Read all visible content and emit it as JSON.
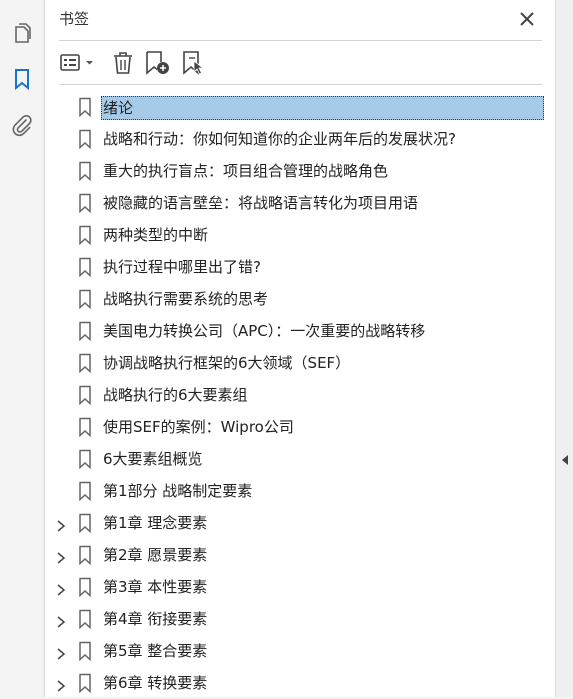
{
  "panel": {
    "title": "书签"
  },
  "rail_icons": [
    "pages-icon",
    "bookmarks-icon",
    "attachments-icon"
  ],
  "toolbar": [
    "options-menu-button",
    "delete-bookmark-button",
    "new-bookmark-button",
    "bookmark-from-selection-button"
  ],
  "bookmarks": [
    {
      "label": "绪论",
      "expandable": false,
      "selected": true
    },
    {
      "label": "战略和行动：你如何知道你的企业两年后的发展状况?",
      "expandable": false
    },
    {
      "label": "重大的执行盲点：项目组合管理的战略角色",
      "expandable": false
    },
    {
      "label": "被隐藏的语言壁垒：将战略语言转化为项目用语",
      "expandable": false
    },
    {
      "label": "两种类型的中断",
      "expandable": false
    },
    {
      "label": "执行过程中哪里出了错?",
      "expandable": false
    },
    {
      "label": "战略执行需要系统的思考",
      "expandable": false
    },
    {
      "label": "美国电力转换公司（APC）：一次重要的战略转移",
      "expandable": false
    },
    {
      "label": "协调战略执行框架的6大领域（SEF）",
      "expandable": false
    },
    {
      "label": "战略执行的6大要素组",
      "expandable": false
    },
    {
      "label": "使用SEF的案例：Wipro公司",
      "expandable": false
    },
    {
      "label": "6大要素组概览",
      "expandable": false
    },
    {
      "label": "第1部分  战略制定要素",
      "expandable": false
    },
    {
      "label": "第1章  理念要素",
      "expandable": true
    },
    {
      "label": "第2章  愿景要素",
      "expandable": true
    },
    {
      "label": "第3章  本性要素",
      "expandable": true
    },
    {
      "label": "第4章  衔接要素",
      "expandable": true
    },
    {
      "label": "第5章  整合要素",
      "expandable": true
    },
    {
      "label": "第6章  转换要素",
      "expandable": true
    }
  ],
  "colors": {
    "selection": "#a6cbe8",
    "accent": "#1a73c8"
  }
}
